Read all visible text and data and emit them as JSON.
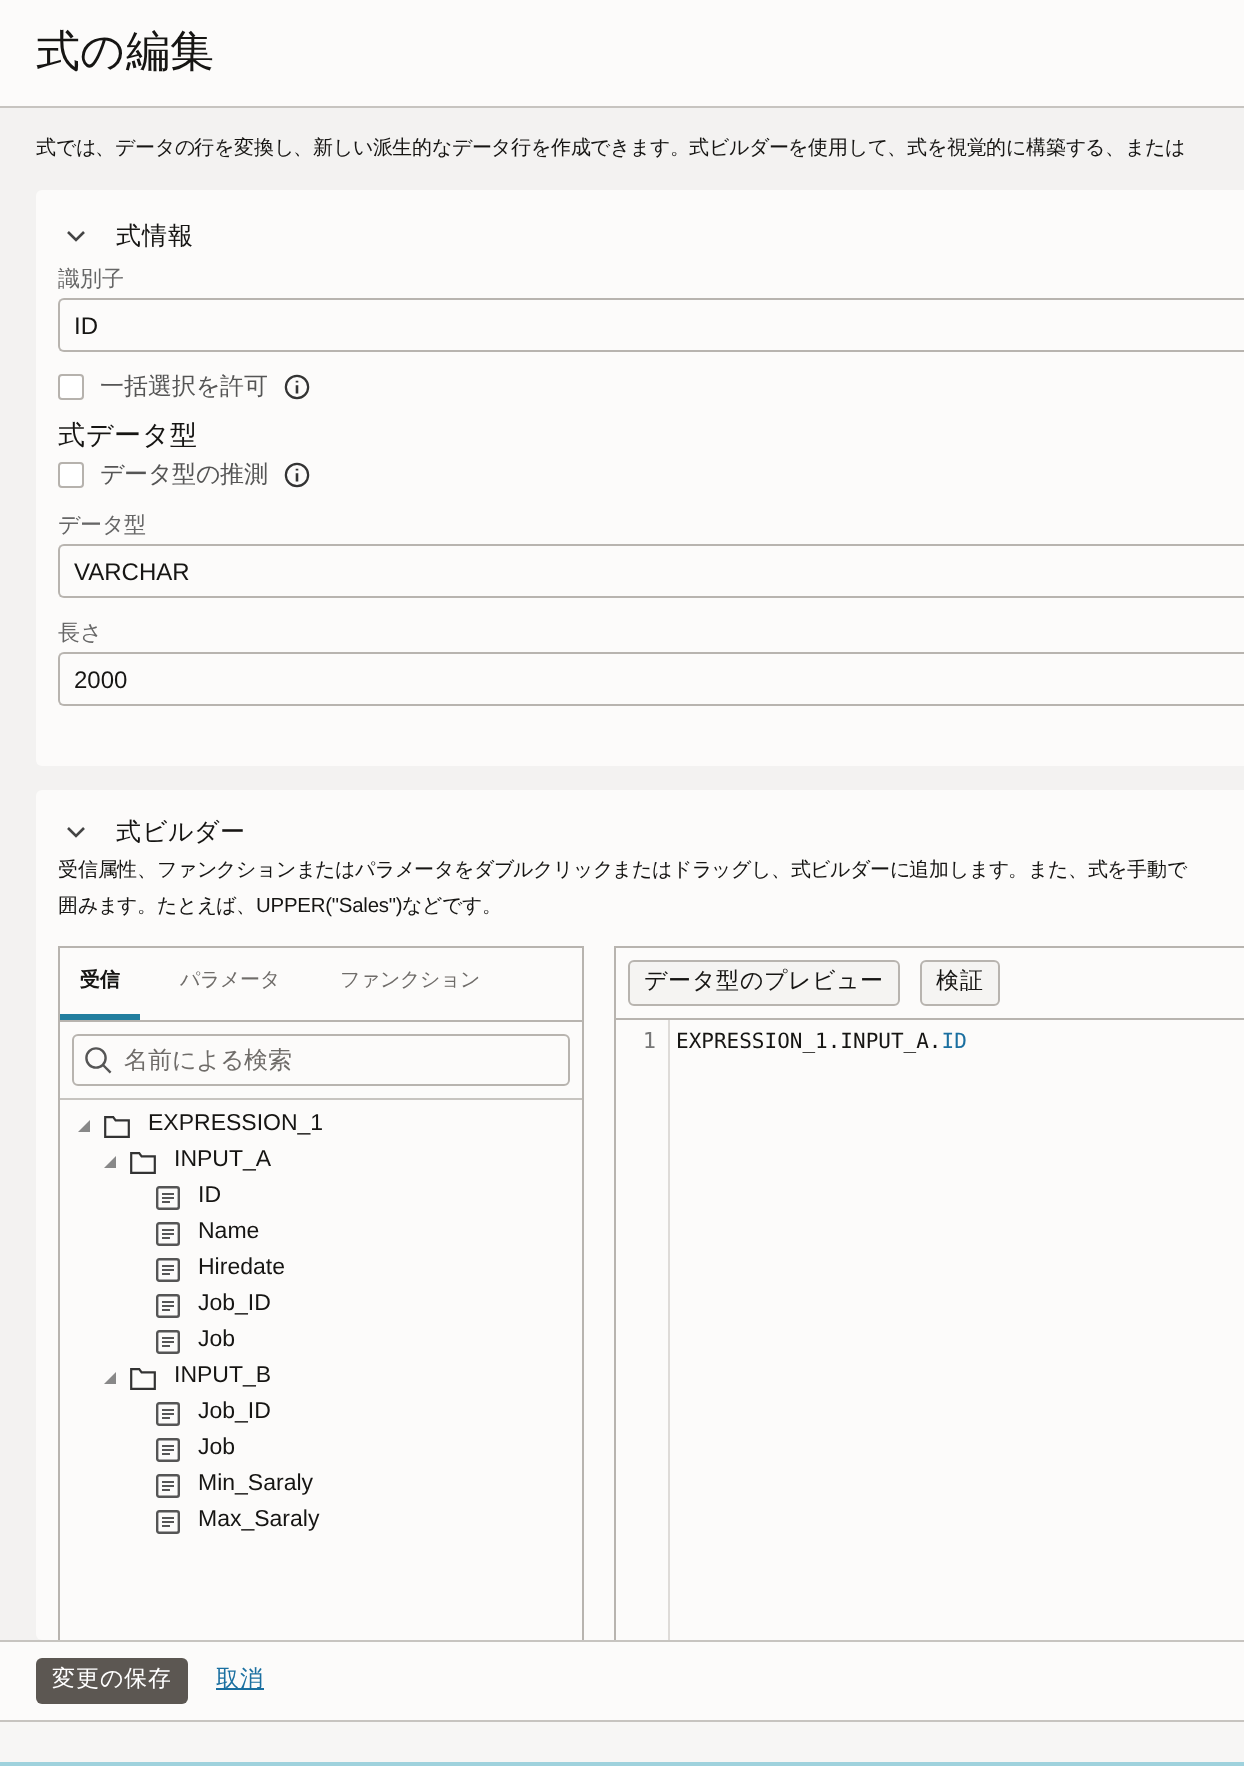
{
  "page_title": "式の編集",
  "intro": "式では、データの行を変換し、新しい派生的なデータ行を作成できます。式ビルダーを使用して、式を視覚的に構築する、または",
  "info_section": {
    "title": "式情報",
    "expanded": true,
    "identifier": {
      "label": "識別子",
      "value": "ID"
    },
    "bulk_select": {
      "label": "一括選択を許可",
      "checked": false
    },
    "datatype_heading": "式データ型",
    "infer": {
      "label": "データ型の推測",
      "checked": false
    },
    "datatype": {
      "label": "データ型",
      "value": "VARCHAR"
    },
    "length": {
      "label": "長さ",
      "value": "2000"
    }
  },
  "builder_section": {
    "title": "式ビルダー",
    "expanded": true,
    "description": [
      "受信属性、ファンクションまたはパラメータをダブルクリックまたはドラッグし、式ビルダーに追加します。また、式を手動で",
      "囲みます。たとえば、UPPER(\"Sales\")などです。"
    ],
    "tabs": [
      {
        "label": "受信",
        "selected": true
      },
      {
        "label": "パラメータ",
        "selected": false
      },
      {
        "label": "ファンクション",
        "selected": false
      }
    ],
    "search": {
      "placeholder": "名前による検索"
    },
    "tree": [
      {
        "label": "EXPRESSION_1",
        "kind": "folder",
        "expanded": true,
        "children": [
          {
            "label": "INPUT_A",
            "kind": "folder",
            "expanded": true,
            "children": [
              {
                "label": "ID",
                "kind": "field"
              },
              {
                "label": "Name",
                "kind": "field"
              },
              {
                "label": "Hiredate",
                "kind": "field"
              },
              {
                "label": "Job_ID",
                "kind": "field"
              },
              {
                "label": "Job",
                "kind": "field"
              }
            ]
          },
          {
            "label": "INPUT_B",
            "kind": "folder",
            "expanded": true,
            "children": [
              {
                "label": "Job_ID",
                "kind": "field"
              },
              {
                "label": "Job",
                "kind": "field"
              },
              {
                "label": "Min_Saraly",
                "kind": "field"
              },
              {
                "label": "Max_Saraly",
                "kind": "field"
              }
            ]
          }
        ]
      }
    ],
    "toolbar": [
      "データ型のプレビュー",
      "検証"
    ],
    "code": [
      {
        "number": "1",
        "segments": [
          {
            "text": "EXPRESSION_1.INPUT_A.",
            "kind": "plain"
          },
          {
            "text": "ID",
            "kind": "identifier"
          }
        ]
      }
    ]
  },
  "footer": {
    "save": "変更の保存",
    "cancel": "取消"
  }
}
